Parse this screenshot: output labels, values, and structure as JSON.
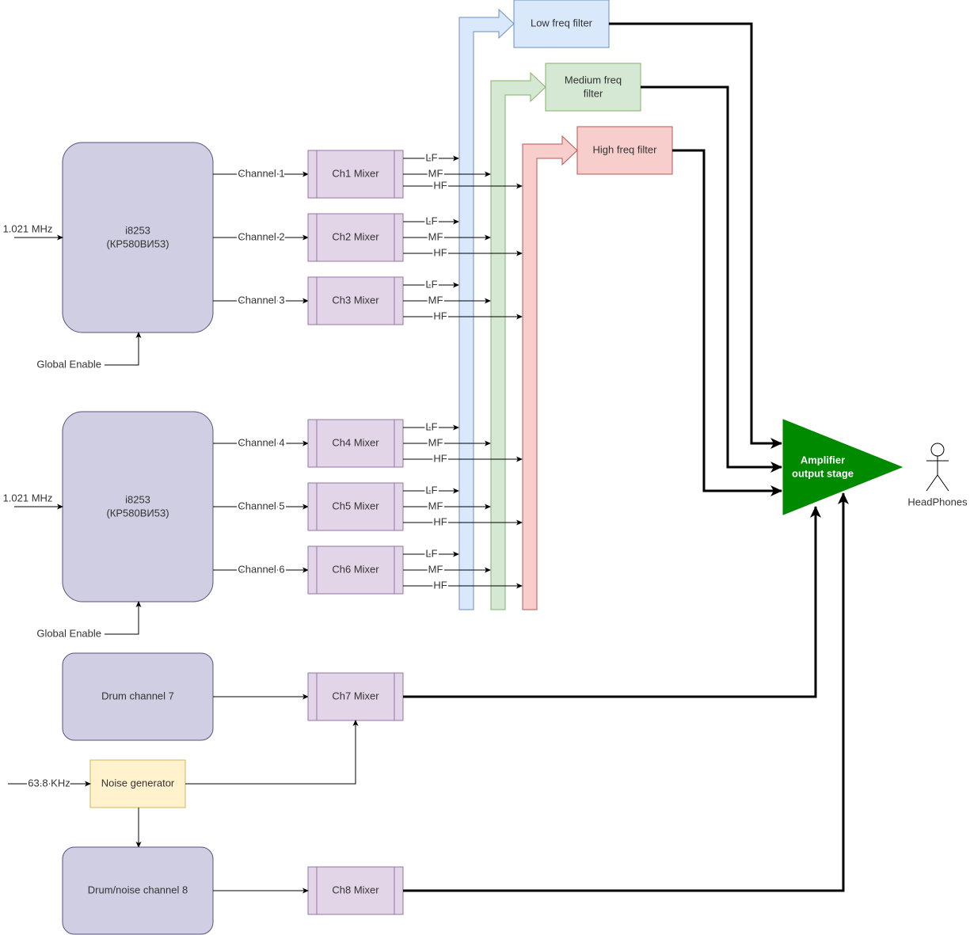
{
  "chips": [
    {
      "line1": "i8253",
      "line2": "(КР580ВИ53)",
      "clock": "1.021 MHz",
      "enable": "Global Enable",
      "channels": [
        "Channel 1",
        "Channel 2",
        "Channel 3"
      ]
    },
    {
      "line1": "i8253",
      "line2": "(КР580ВИ53)",
      "clock": "1.021 MHz",
      "enable": "Global Enable",
      "channels": [
        "Channel 4",
        "Channel 5",
        "Channel 6"
      ]
    }
  ],
  "mixers": [
    "Ch1 Mixer",
    "Ch2 Mixer",
    "Ch3 Mixer",
    "Ch4 Mixer",
    "Ch5 Mixer",
    "Ch6 Mixer",
    "Ch7 Mixer",
    "Ch8 Mixer"
  ],
  "band_labels": {
    "lf": "LF",
    "mf": "MF",
    "hf": "HF"
  },
  "filters": {
    "low": {
      "line1": "Low freq filter",
      "line2": "",
      "fill": "#dae8fc",
      "stroke": "#6c8ebf"
    },
    "medium": {
      "line1": "Medium freq",
      "line2": "filter",
      "fill": "#d5e8d4",
      "stroke": "#82b366"
    },
    "high": {
      "line1": "High freq filter",
      "line2": "",
      "fill": "#f8cecc",
      "stroke": "#b85450"
    }
  },
  "drum7": "Drum channel 7",
  "noise": {
    "label": "Noise generator",
    "clock": "63.8 KHz",
    "fill": "#fff2cc",
    "stroke": "#d6b656"
  },
  "drum8": "Drum/noise channel 8",
  "amplifier": {
    "line1": "Amplifier",
    "line2": "output stage",
    "fill": "#008a00"
  },
  "output": "HeadPhones",
  "colors": {
    "chip_fill": "#d0cee2",
    "chip_stroke": "#56517e",
    "mixer_fill": "#e1d5e7",
    "mixer_stroke": "#9673a6"
  }
}
